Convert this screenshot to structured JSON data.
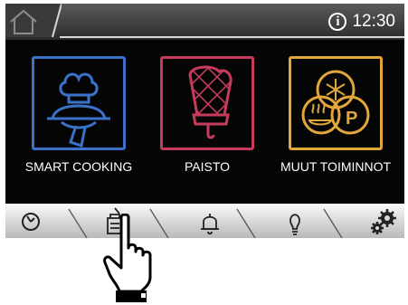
{
  "header": {
    "time": "12:30",
    "icons": [
      "home-icon",
      "info-icon"
    ]
  },
  "tiles": [
    {
      "label": "SMART COOKING",
      "color": "#3b72c9",
      "icon": "chef-cloche-icon"
    },
    {
      "label": "PAISTO",
      "color": "#c63b5b",
      "icon": "oven-mitt-icon"
    },
    {
      "label": "MUUT TOIMINNOT",
      "color": "#e1a73a",
      "icon": "other-functions-icon"
    }
  ],
  "bottom_nav": {
    "items": [
      "timer-icon",
      "cookbook-icon",
      "bell-icon",
      "bulb-icon",
      "settings-icon"
    ],
    "active": "cookbook-icon"
  },
  "pointer": {
    "icon": "pointing-hand-icon"
  }
}
